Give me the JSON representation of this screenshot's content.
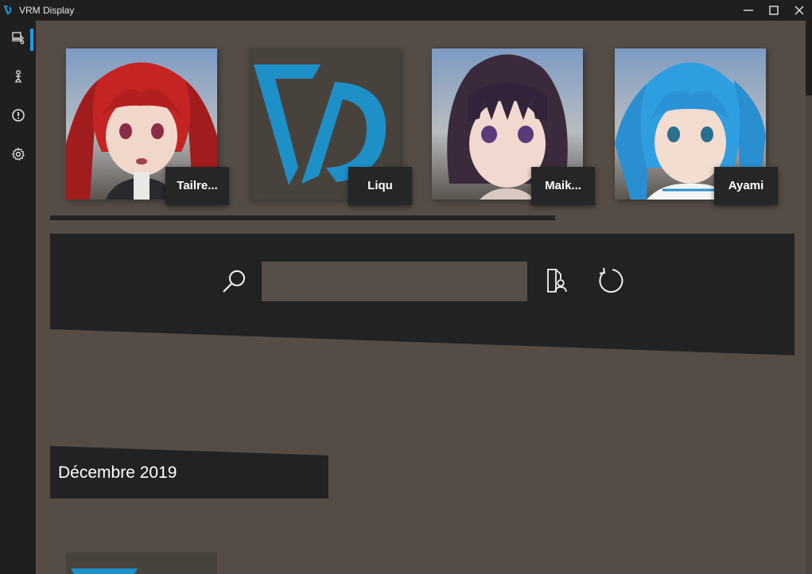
{
  "window": {
    "title": "VRM Display",
    "icon": "vrm-display-logo",
    "controls": [
      "minimize-icon",
      "maximize-icon",
      "close-icon"
    ]
  },
  "sidebar": {
    "items": [
      {
        "name": "models",
        "icon": "models-icon",
        "active": true
      },
      {
        "name": "avatar",
        "icon": "avatar-pose-icon",
        "active": false
      },
      {
        "name": "info",
        "icon": "alert-circle-icon",
        "active": false
      },
      {
        "name": "settings",
        "icon": "gear-icon",
        "active": false
      }
    ],
    "accent_color": "#1aa0e6"
  },
  "models": [
    {
      "label": "Tailre...",
      "thumbnail": "red-haired-avatar"
    },
    {
      "label": "Liqu",
      "thumbnail": "vd-logo"
    },
    {
      "label": "Maik...",
      "thumbnail": "dark-haired-avatar"
    },
    {
      "label": "Ayami",
      "thumbnail": "blue-haired-avatar"
    }
  ],
  "search": {
    "value": "",
    "placeholder": "",
    "search_icon": "search-icon",
    "filter_icon": "user-file-icon",
    "refresh_icon": "refresh-icon"
  },
  "groups": [
    {
      "heading": "Décembre 2019"
    }
  ],
  "colors": {
    "background": "#544c45",
    "panel": "#222222",
    "brand": "#1e90c8"
  }
}
